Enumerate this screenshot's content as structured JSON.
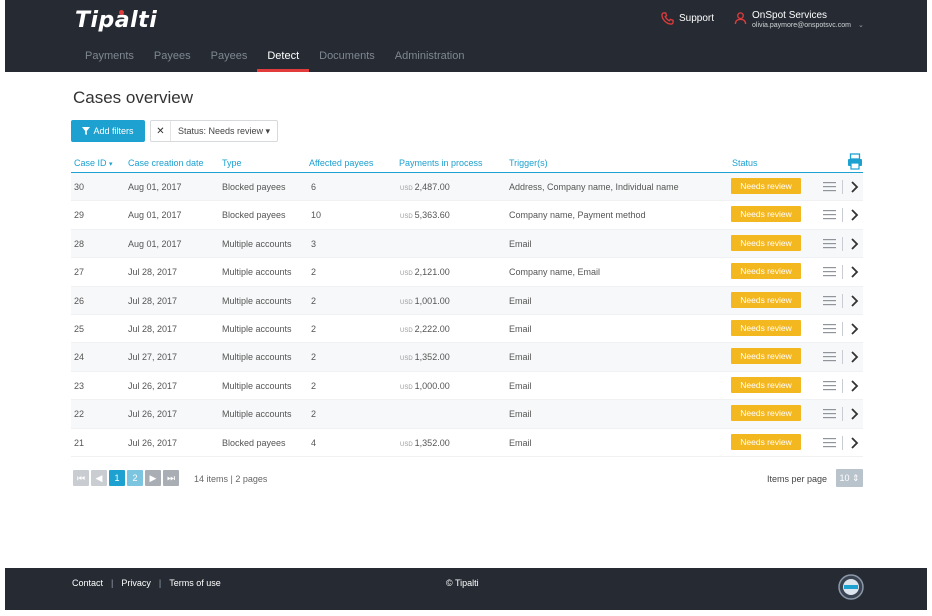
{
  "header": {
    "logo": "Tipalti",
    "support_label": "Support",
    "account_org": "OnSpot Services",
    "account_email": "olivia.paymore@onspotsvc.com",
    "nav": [
      {
        "label": "Payments"
      },
      {
        "label": "Payees"
      },
      {
        "label": "Payees"
      },
      {
        "label": "Detect"
      },
      {
        "label": "Documents"
      },
      {
        "label": "Administration"
      }
    ]
  },
  "page": {
    "title": "Cases overview",
    "add_filters_label": "Add filters",
    "filter_chip_label": "Status: Needs review"
  },
  "table": {
    "columns": [
      "Case ID",
      "Case creation date",
      "Type",
      "Affected payees",
      "Payments in process",
      "Trigger(s)",
      "Status"
    ],
    "currency_label": "USD",
    "rows": [
      {
        "id": "30",
        "date": "Aug 01, 2017",
        "type": "Blocked payees",
        "affected": "6",
        "payments": "2,487.00",
        "triggers": "Address, Company name, Individual name",
        "status": "Needs review"
      },
      {
        "id": "29",
        "date": "Aug 01, 2017",
        "type": "Blocked payees",
        "affected": "10",
        "payments": "5,363.60",
        "triggers": "Company name, Payment method",
        "status": "Needs review"
      },
      {
        "id": "28",
        "date": "Aug 01, 2017",
        "type": "Multiple accounts",
        "affected": "3",
        "payments": "",
        "triggers": "Email",
        "status": "Needs review"
      },
      {
        "id": "27",
        "date": "Jul 28, 2017",
        "type": "Multiple accounts",
        "affected": "2",
        "payments": "2,121.00",
        "triggers": "Company name, Email",
        "status": "Needs review"
      },
      {
        "id": "26",
        "date": "Jul 28, 2017",
        "type": "Multiple accounts",
        "affected": "2",
        "payments": "1,001.00",
        "triggers": "Email",
        "status": "Needs review"
      },
      {
        "id": "25",
        "date": "Jul 28, 2017",
        "type": "Multiple accounts",
        "affected": "2",
        "payments": "2,222.00",
        "triggers": "Email",
        "status": "Needs review"
      },
      {
        "id": "24",
        "date": "Jul 27, 2017",
        "type": "Multiple accounts",
        "affected": "2",
        "payments": "1,352.00",
        "triggers": "Email",
        "status": "Needs review"
      },
      {
        "id": "23",
        "date": "Jul 26, 2017",
        "type": "Multiple accounts",
        "affected": "2",
        "payments": "1,000.00",
        "triggers": "Email",
        "status": "Needs review"
      },
      {
        "id": "22",
        "date": "Jul 26, 2017",
        "type": "Multiple accounts",
        "affected": "2",
        "payments": "",
        "triggers": "Email",
        "status": "Needs review"
      },
      {
        "id": "21",
        "date": "Jul 26, 2017",
        "type": "Blocked payees",
        "affected": "4",
        "payments": "1,352.00",
        "triggers": "Email",
        "status": "Needs review"
      }
    ]
  },
  "pagination": {
    "pages": [
      "1",
      "2"
    ],
    "info": "14 items | 2 pages",
    "items_per_page_label": "Items per page",
    "items_per_page_value": "10"
  },
  "footer": {
    "contact": "Contact",
    "privacy": "Privacy",
    "terms": "Terms of use",
    "copyright": "© Tipalti"
  },
  "colors": {
    "accent": "#1da1d0",
    "status_badge": "#f3b71f",
    "nav_active": "#e23b3b",
    "header_bg": "#262b33"
  },
  "icons": [
    "phone-icon",
    "user-icon",
    "filter-icon",
    "close-icon",
    "sort-down-icon",
    "print-icon",
    "menu-icon",
    "chevron-right-icon",
    "first-page-icon",
    "prev-page-icon",
    "next-page-icon",
    "last-page-icon",
    "seal-icon"
  ]
}
